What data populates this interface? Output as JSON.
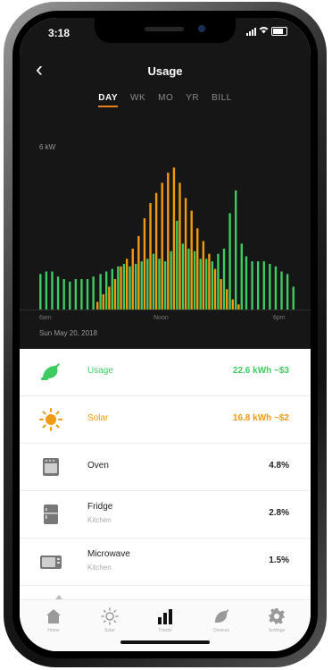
{
  "status": {
    "time": "3:18"
  },
  "header": {
    "back_label": "‹",
    "title": "Usage"
  },
  "tabs": [
    {
      "label": "DAY",
      "active": true
    },
    {
      "label": "WK",
      "active": false
    },
    {
      "label": "MO",
      "active": false
    },
    {
      "label": "YR",
      "active": false
    },
    {
      "label": "BILL",
      "active": false
    }
  ],
  "chart": {
    "ylabel": "6 kW",
    "xlabels": [
      "6am",
      "Noon",
      "6pm"
    ],
    "date": "Sun May 20, 2018",
    "colors": {
      "usage": "#3ecb62",
      "solar": "#f29a0e"
    }
  },
  "chart_data": {
    "type": "bar",
    "ylabel": "6 kW",
    "ylim": [
      0,
      6
    ],
    "categories": [
      "0",
      "1",
      "2",
      "3",
      "4",
      "5",
      "6",
      "7",
      "8",
      "9",
      "10",
      "11",
      "12",
      "13",
      "14",
      "15",
      "16",
      "17",
      "18",
      "19",
      "20",
      "21",
      "22",
      "23",
      "24",
      "25",
      "26",
      "27",
      "28",
      "29",
      "30",
      "31",
      "32",
      "33",
      "34",
      "35",
      "36",
      "37",
      "38",
      "39",
      "40",
      "41",
      "42",
      "43"
    ],
    "series": [
      {
        "name": "Usage",
        "values": [
          1.4,
          1.5,
          1.5,
          1.3,
          1.2,
          1.1,
          1.2,
          1.2,
          1.2,
          1.3,
          1.4,
          1.5,
          1.6,
          1.7,
          1.8,
          1.7,
          1.8,
          1.9,
          2.0,
          2.2,
          2.0,
          1.9,
          2.3,
          3.5,
          2.6,
          2.4,
          2.3,
          2.0,
          2.0,
          1.9,
          2.2,
          2.4,
          3.8,
          4.7,
          2.6,
          2.1,
          1.9,
          1.9,
          1.9,
          1.8,
          1.7,
          1.5,
          1.4,
          0.9
        ]
      },
      {
        "name": "Solar",
        "values": [
          0,
          0,
          0,
          0,
          0,
          0,
          0,
          0,
          0,
          0,
          0.3,
          0.6,
          0.9,
          1.2,
          1.7,
          2.0,
          2.4,
          2.9,
          3.6,
          4.2,
          4.6,
          5.0,
          5.4,
          5.6,
          5.0,
          4.4,
          3.9,
          3.2,
          2.7,
          2.2,
          1.6,
          1.2,
          0.8,
          0.4,
          0.2,
          0,
          0,
          0,
          0,
          0,
          0,
          0,
          0,
          0
        ]
      }
    ]
  },
  "list": [
    {
      "label": "Usage",
      "sub": "",
      "value": "22.6 kWh  ~$3",
      "icon": "plug-icon",
      "color": "green"
    },
    {
      "label": "Solar",
      "sub": "",
      "value": "16.8 kWh  ~$2",
      "icon": "sun-icon",
      "color": "orange"
    },
    {
      "label": "Oven",
      "sub": "",
      "value": "4.8%",
      "icon": "oven-icon",
      "color": ""
    },
    {
      "label": "Fridge",
      "sub": "Kitchen",
      "value": "2.8%",
      "icon": "fridge-icon",
      "color": ""
    },
    {
      "label": "Microwave",
      "sub": "Kitchen",
      "value": "1.5%",
      "icon": "microwave-icon",
      "color": ""
    }
  ],
  "tabbar": [
    {
      "label": "Home",
      "icon": "home-icon"
    },
    {
      "label": "Solar",
      "icon": "solar-icon"
    },
    {
      "label": "Trends",
      "icon": "trends-icon",
      "active": true
    },
    {
      "label": "Devices",
      "icon": "devices-icon"
    },
    {
      "label": "Settings",
      "icon": "settings-icon"
    }
  ]
}
